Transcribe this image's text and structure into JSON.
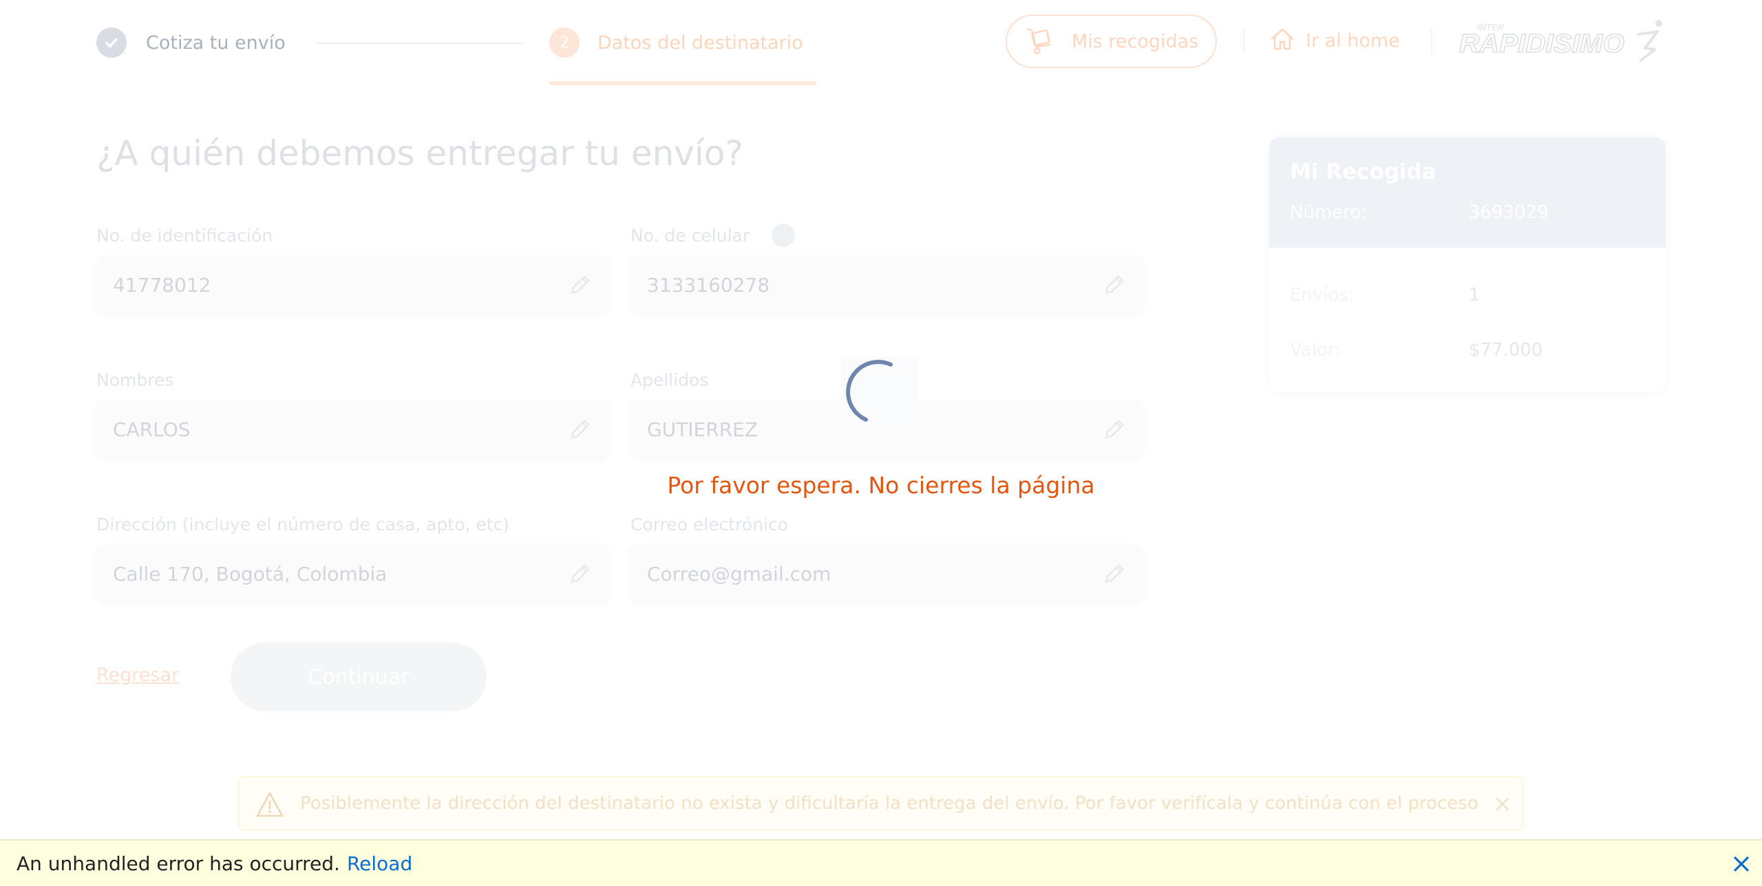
{
  "header": {
    "step1_label": "Cotiza tu envío",
    "step2_number": "2",
    "step2_label": "Datos del destinatario",
    "pickups_label": "Mis recogidas",
    "home_label": "Ir al home",
    "logo_small": "INTER",
    "logo_text": "RAPIDISIMO",
    "colors": {
      "accent": "#e6550d",
      "accent_faded": "#fcd6bf"
    }
  },
  "page": {
    "title": "¿A quién debemos entregar tu envío?"
  },
  "form": {
    "id_label": "No. de identificación",
    "id_value": "41778012",
    "phone_label": "No. de celular",
    "phone_value": "3133160278",
    "name_label": "Nombres",
    "name_value": "CARLOS",
    "surname_label": "Apellidos",
    "surname_value": "GUTIERREZ",
    "address_label": "Dirección (incluye el número de casa, apto, etc)",
    "address_value": "Calle 170, Bogotá, Colombia",
    "email_label": "Correo electrónico",
    "email_value": "Correo@gmail.com"
  },
  "actions": {
    "back_label": "Regresar",
    "continue_label": "Continuar"
  },
  "pickup_card": {
    "title": "Mi Recogida",
    "number_label": "Número:",
    "number_value": "3693029",
    "shipments_label": "Envíos:",
    "shipments_value": "1",
    "value_label": "Valor:",
    "value_value": "$77.000"
  },
  "warning": {
    "text": "Posiblemente la dirección del destinatario no exista y dificultaría la entrega del envío. Por favor verifícala y continúa con el proceso"
  },
  "loader": {
    "message": "Por favor espera. No cierres la página"
  },
  "error_bar": {
    "message": "An unhandled error has occurred.",
    "reload_label": "Reload",
    "close_symbol": "✕"
  }
}
